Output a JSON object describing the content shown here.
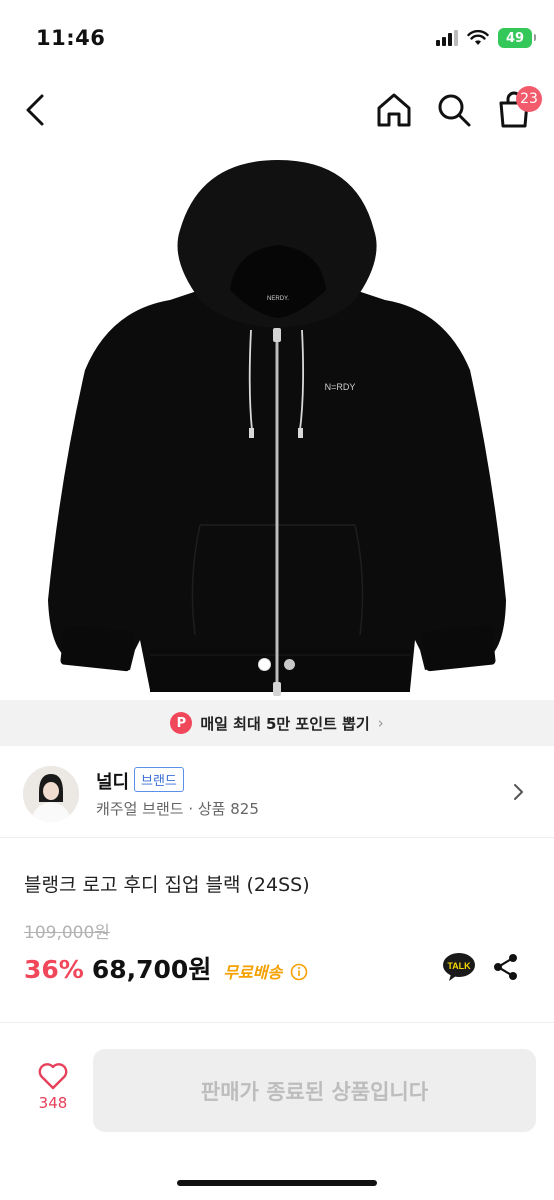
{
  "status_bar": {
    "time": "11:46",
    "battery": "49"
  },
  "nav": {
    "cart_count": "23"
  },
  "product_image": {
    "logo_on_garment": "N=RDY",
    "hood_label": "NERDY.",
    "slide_count": 2,
    "active_slide": 1
  },
  "promo": {
    "icon_letter": "P",
    "text": "매일 최대 5만 포인트 뽑기",
    "chevron": "›"
  },
  "brand": {
    "name": "널디",
    "tag": "브랜드",
    "subtitle": "캐주얼 브랜드 · 상품 825"
  },
  "product": {
    "name": "블랭크 로고 후디 집업 블랙 (24SS)",
    "original_price": "109,000원",
    "discount": "36%",
    "price": "68,700원",
    "shipping": "무료배송",
    "talk_label": "TALK"
  },
  "bottom": {
    "like_count": "348",
    "sold_out_label": "판매가 종료된 상품입니다"
  },
  "colors": {
    "accent_red": "#f1475a",
    "shipping_orange": "#f5a100",
    "brand_blue": "#3b6fd6"
  }
}
